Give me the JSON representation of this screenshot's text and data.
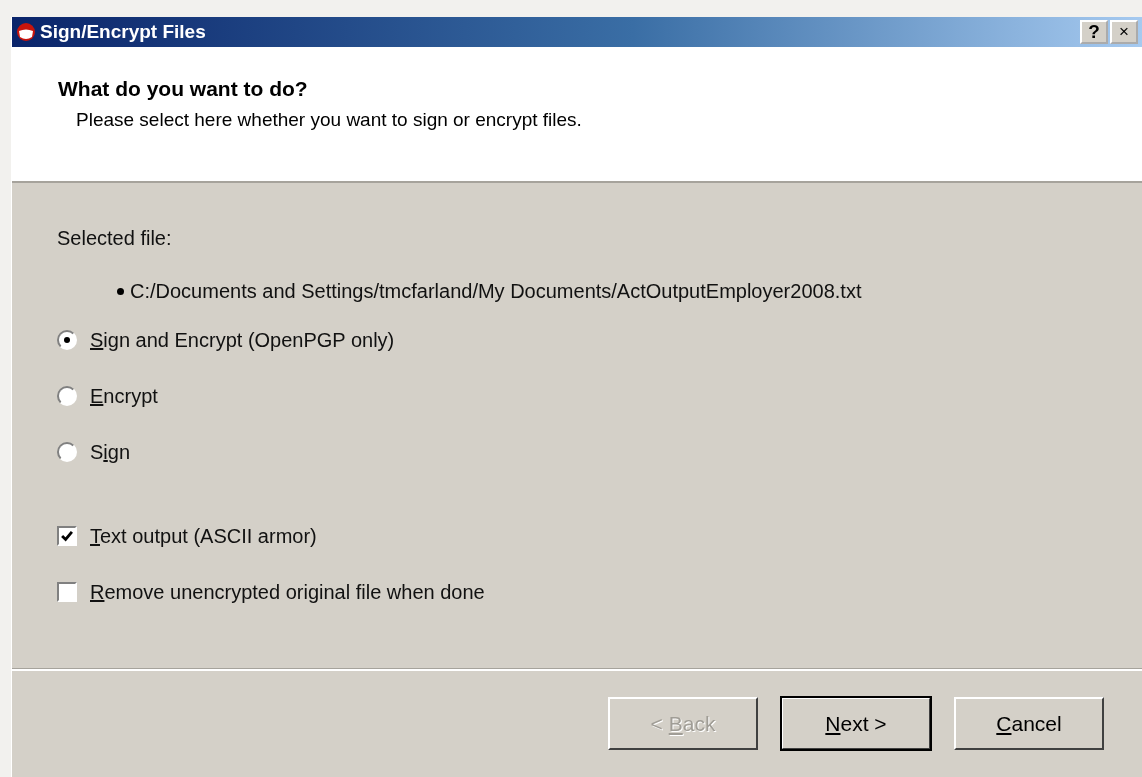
{
  "window": {
    "title": "Sign/Encrypt Files",
    "controls": [
      {
        "kind": "help",
        "label": "?"
      },
      {
        "kind": "close",
        "label": "×"
      }
    ]
  },
  "header": {
    "heading": "What do you want to do?",
    "description": "Please select here whether you want to sign or encrypt files."
  },
  "selected_file_label": "Selected file:",
  "files": [
    "C:/Documents and Settings/tmcfarland/My Documents/ActOutputEmployer2008.txt"
  ],
  "operations": [
    {
      "mnemonic": "S",
      "label_after": "ign and Encrypt (OpenPGP only)",
      "selected": true
    },
    {
      "mnemonic": "E",
      "label_after": "ncrypt",
      "selected": false
    },
    {
      "label_before": "S",
      "mnemonic": "i",
      "label_after": "gn",
      "selected": false
    }
  ],
  "options": [
    {
      "mnemonic": "T",
      "label_after": "ext output (ASCII armor)",
      "checked": true
    },
    {
      "mnemonic": "R",
      "label_after": "emove unencrypted original file when done",
      "checked": false
    }
  ],
  "buttons": [
    {
      "label_before": "< ",
      "mnemonic": "B",
      "label_after": "ack",
      "disabled": true,
      "default": false
    },
    {
      "mnemonic": "N",
      "label_after": "ext >",
      "disabled": false,
      "default": true
    },
    {
      "mnemonic": "C",
      "label_after": "ancel",
      "disabled": false,
      "default": false
    }
  ]
}
